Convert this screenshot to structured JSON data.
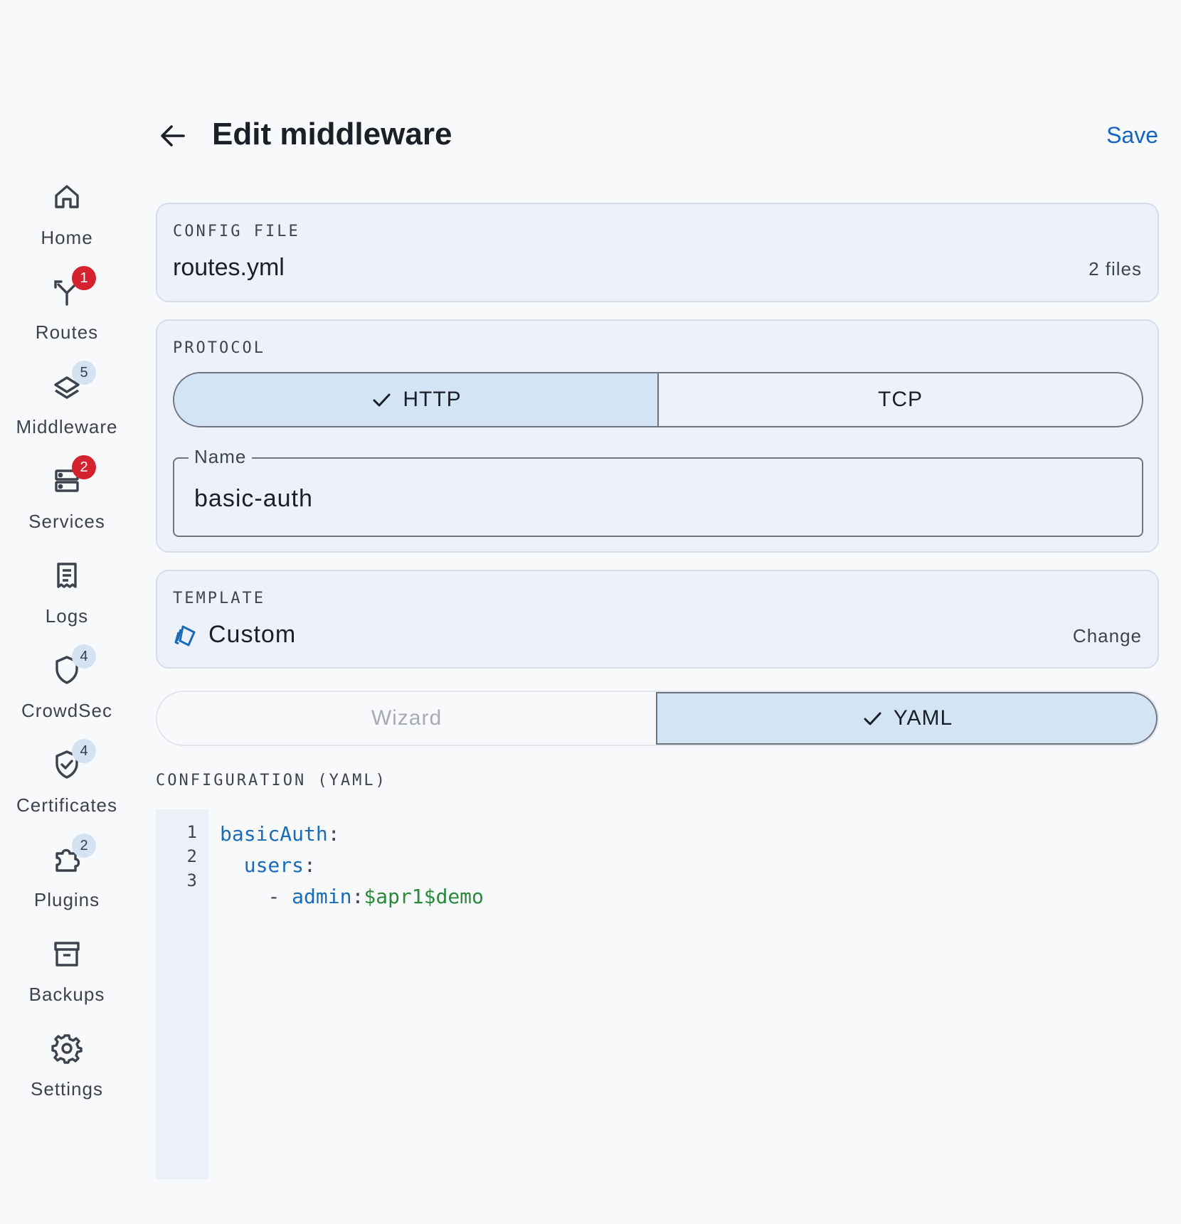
{
  "nav": {
    "items": [
      {
        "label": "Home",
        "icon": "home-icon",
        "badge": ""
      },
      {
        "label": "Routes",
        "icon": "routes-icon",
        "badge": "1",
        "badge_style": "red"
      },
      {
        "label": "Middleware",
        "icon": "layers-icon",
        "badge": "5",
        "badge_style": "soft"
      },
      {
        "label": "Services",
        "icon": "server-icon",
        "badge": "2",
        "badge_style": "red"
      },
      {
        "label": "Logs",
        "icon": "receipt-icon",
        "badge": ""
      },
      {
        "label": "CrowdSec",
        "icon": "shield-icon",
        "badge": "4",
        "badge_style": "soft"
      },
      {
        "label": "Certificates",
        "icon": "shield-check-icon",
        "badge": "4",
        "badge_style": "soft"
      },
      {
        "label": "Plugins",
        "icon": "puzzle-icon",
        "badge": "2",
        "badge_style": "soft"
      },
      {
        "label": "Backups",
        "icon": "archive-icon",
        "badge": ""
      },
      {
        "label": "Settings",
        "icon": "gear-icon",
        "badge": ""
      }
    ]
  },
  "header": {
    "title": "Edit middleware",
    "save_label": "Save"
  },
  "config_file": {
    "label": "CONFIG FILE",
    "value": "routes.yml",
    "count": "2 files"
  },
  "protocol": {
    "label": "PROTOCOL",
    "options": [
      "HTTP",
      "TCP"
    ],
    "selected": "HTTP",
    "name_label": "Name",
    "name_value": "basic-auth"
  },
  "template": {
    "label": "TEMPLATE",
    "value": "Custom",
    "change_label": "Change"
  },
  "mode": {
    "options": [
      "Wizard",
      "YAML"
    ],
    "selected": "YAML"
  },
  "yaml": {
    "label": "CONFIGURATION (YAML)",
    "line_numbers": [
      "1",
      "2",
      "3"
    ],
    "line1_key": "basicAuth",
    "line2_key": "users",
    "line3_dash": "- ",
    "line3_key": "admin",
    "line3_value": "$apr1$demo"
  },
  "colors": {
    "accent": "#1565c0",
    "badge_red": "#d4232f",
    "badge_soft": "#d3e3f2",
    "selected_segment": "#d3e4f4",
    "card_bg": "#edf1fa",
    "yaml_key": "#1a6bb8",
    "yaml_string": "#2a8a3c"
  }
}
